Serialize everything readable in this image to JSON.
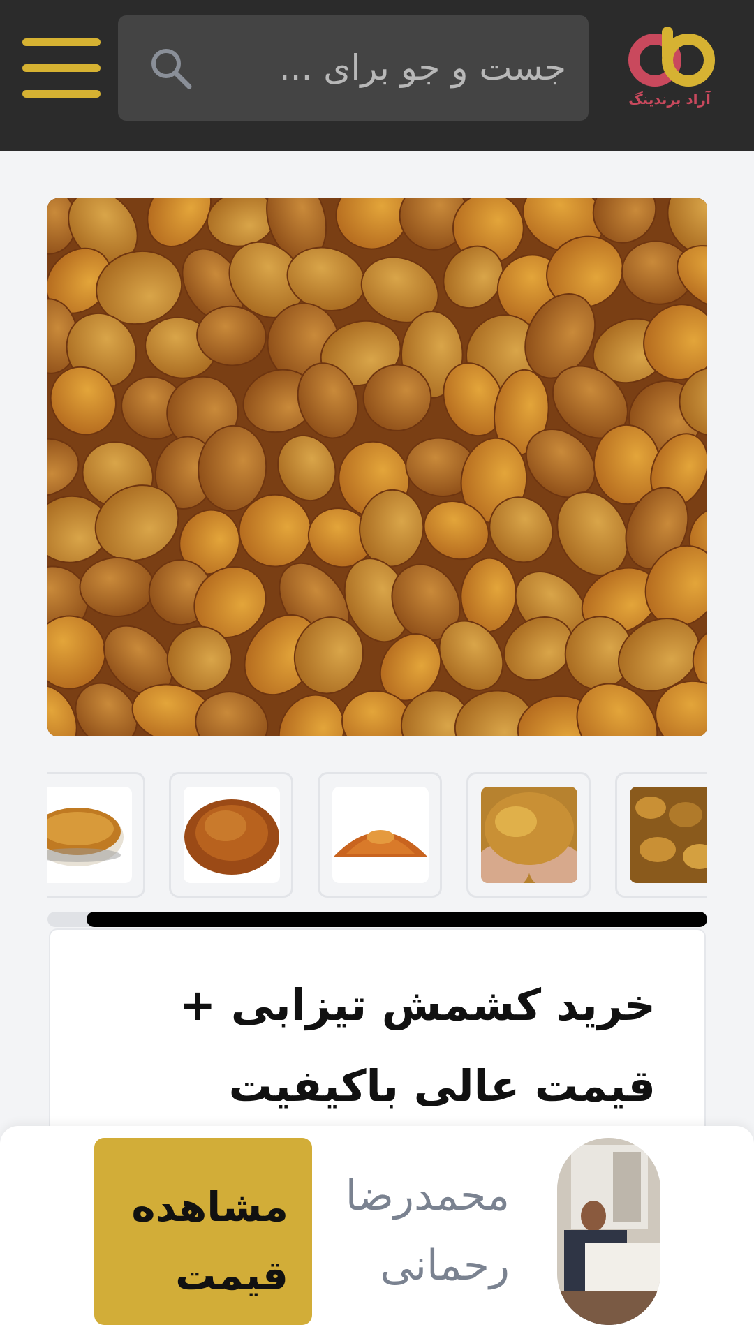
{
  "header": {
    "logo_text": "آراد برندینگ",
    "search_placeholder": "جست و جو برای ...",
    "menu_icon": "hamburger-menu-icon",
    "search_icon": "search-icon"
  },
  "gallery": {
    "main_image_alt": "raisins-photo",
    "thumbnails": [
      {
        "icon": "raisins-bowl-thumbnail"
      },
      {
        "icon": "raisins-pile-thumbnail"
      },
      {
        "icon": "raisins-small-pile-thumbnail"
      },
      {
        "icon": "raisins-in-hands-thumbnail"
      },
      {
        "icon": "raisins-closeup-thumbnail"
      }
    ],
    "scroll_position": 0.94
  },
  "product": {
    "title": "خرید کشمش تیزابی + قیمت عالی باکیفیت"
  },
  "seller": {
    "name": "محمدرضا رحمانی",
    "button_label": "مشاهده قیمت"
  },
  "colors": {
    "header_bg": "#2b2b2b",
    "accent_gold": "#d2ad38",
    "logo_pink": "#c9495d"
  }
}
